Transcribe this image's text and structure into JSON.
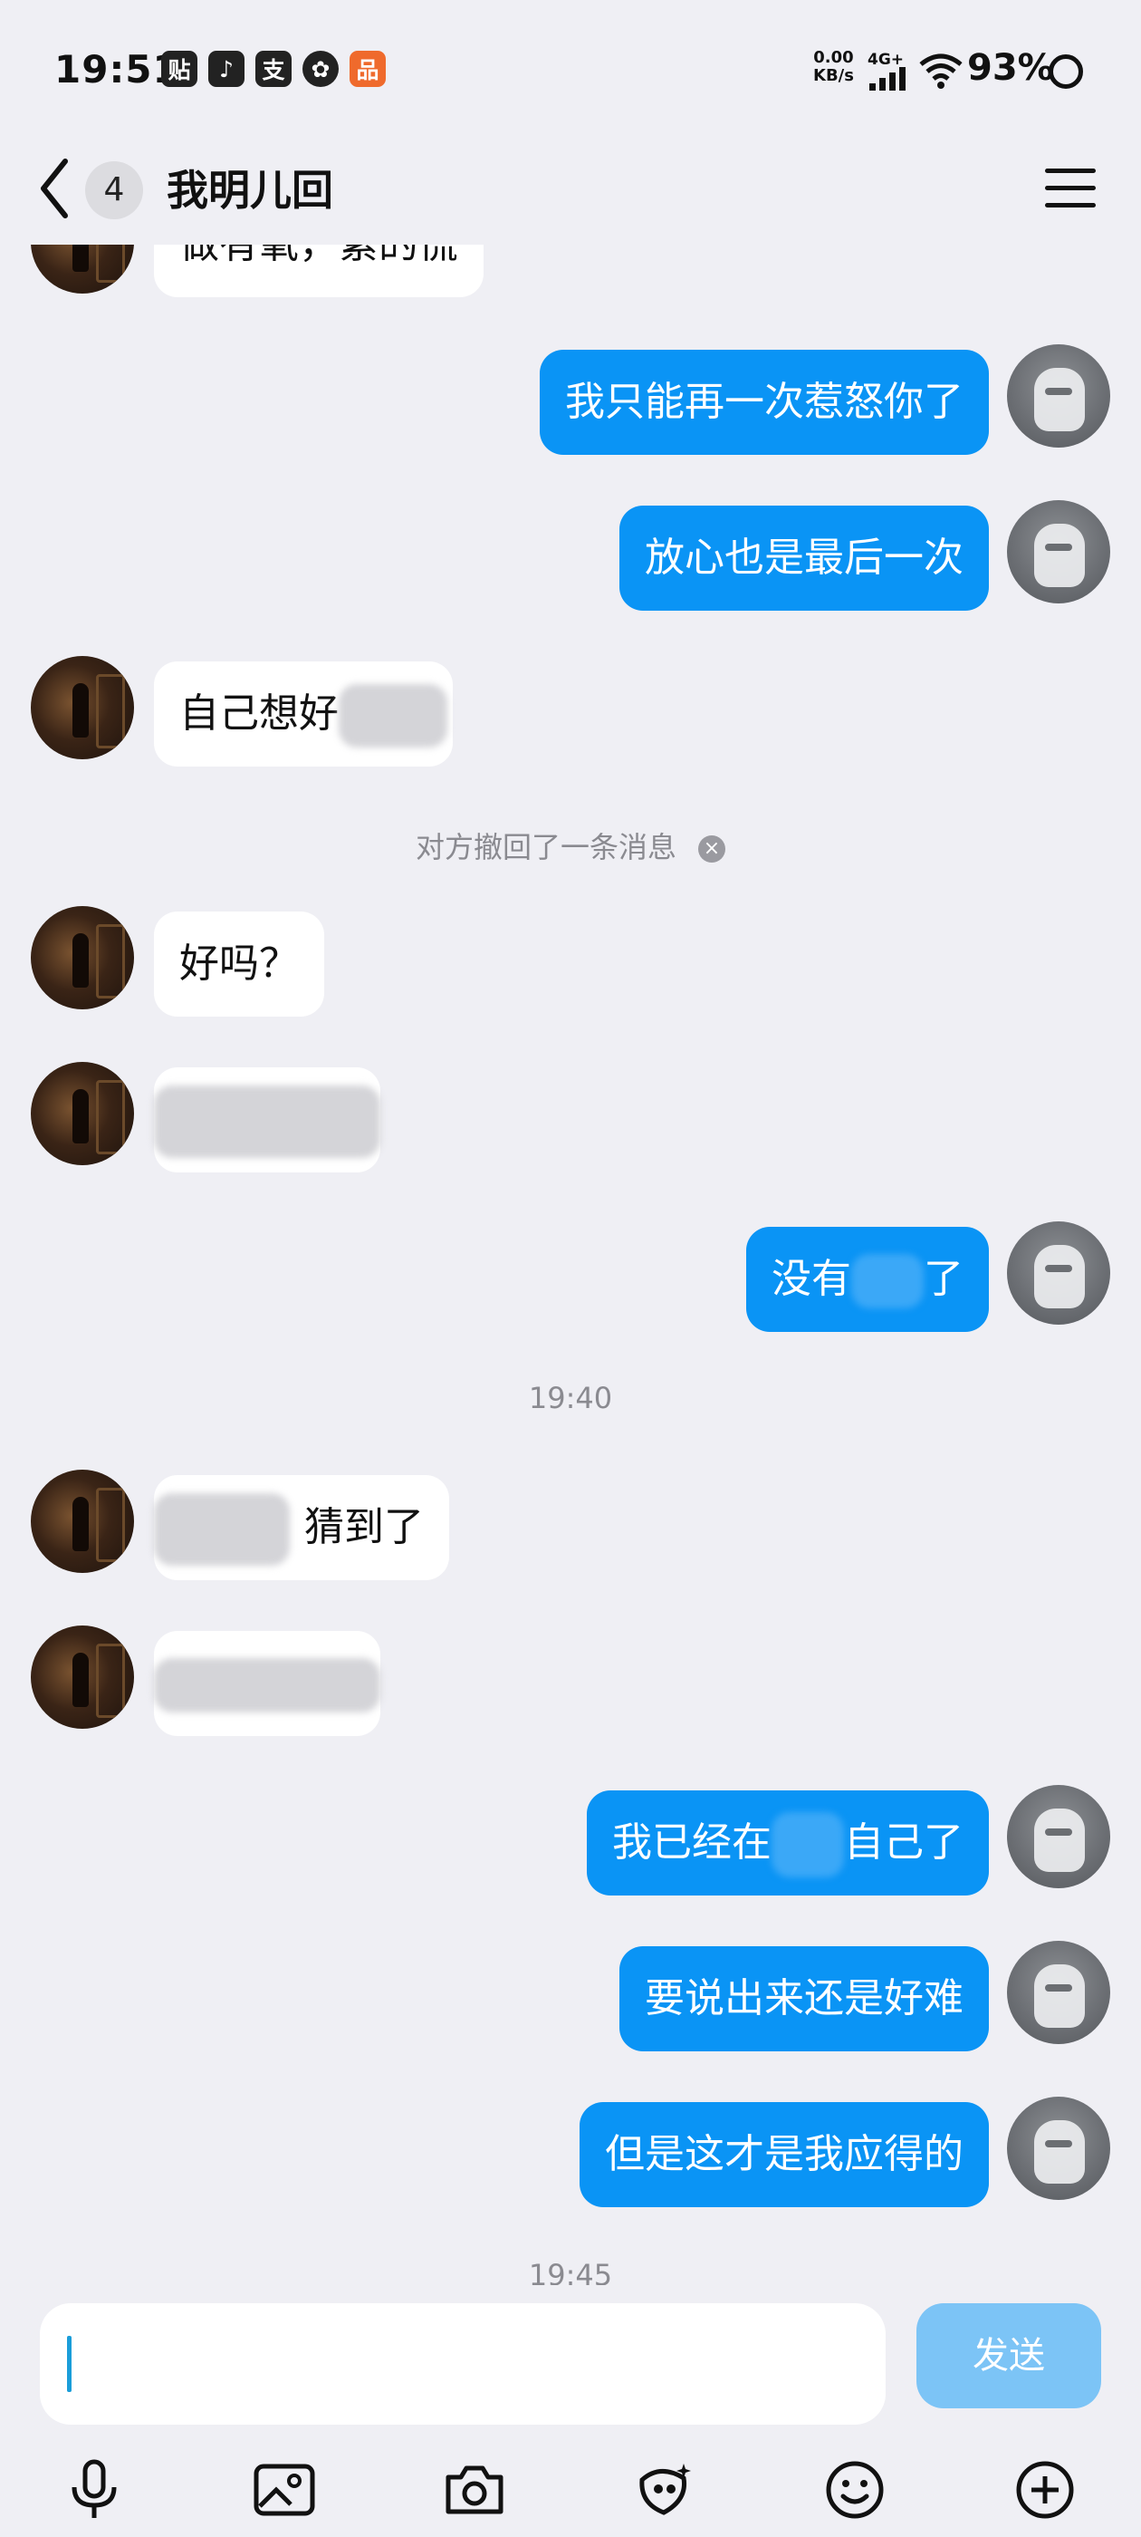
{
  "status_bar": {
    "time": "19:51",
    "app_icons": [
      "贴",
      "♪",
      "支",
      "✿",
      "品"
    ],
    "net_speed_value": "0.00",
    "net_speed_unit": "KB/s",
    "net_type": "4G+",
    "battery": "93%"
  },
  "header": {
    "unread_count": "4",
    "title": "我明儿回"
  },
  "messages": {
    "m0": "做有氧，紧的慌",
    "m1": "我只能再一次惹怒你了",
    "m2": "放心也是最后一次",
    "m3": "自己想好",
    "recall_notice": "对方撤回了一条消息",
    "m4": "好吗？",
    "m6_a": "没有",
    "m6_b": "了",
    "time_1": "19:40",
    "m7": "猜到了",
    "m9_a": "我已经在",
    "m9_b": "自己了",
    "m10": "要说出来还是好难",
    "m11": "但是这才是我应得的",
    "time_2": "19:45"
  },
  "input": {
    "value": "",
    "send_label": "发送"
  },
  "toolbar": [
    "microphone-icon",
    "image-icon",
    "camera-icon",
    "red-packet-icon",
    "emoji-icon",
    "plus-icon"
  ],
  "colors": {
    "background": "#efeff4",
    "bubble_me": "#0a94f5",
    "bubble_them": "#ffffff",
    "send_button": "#7cc4f6"
  }
}
